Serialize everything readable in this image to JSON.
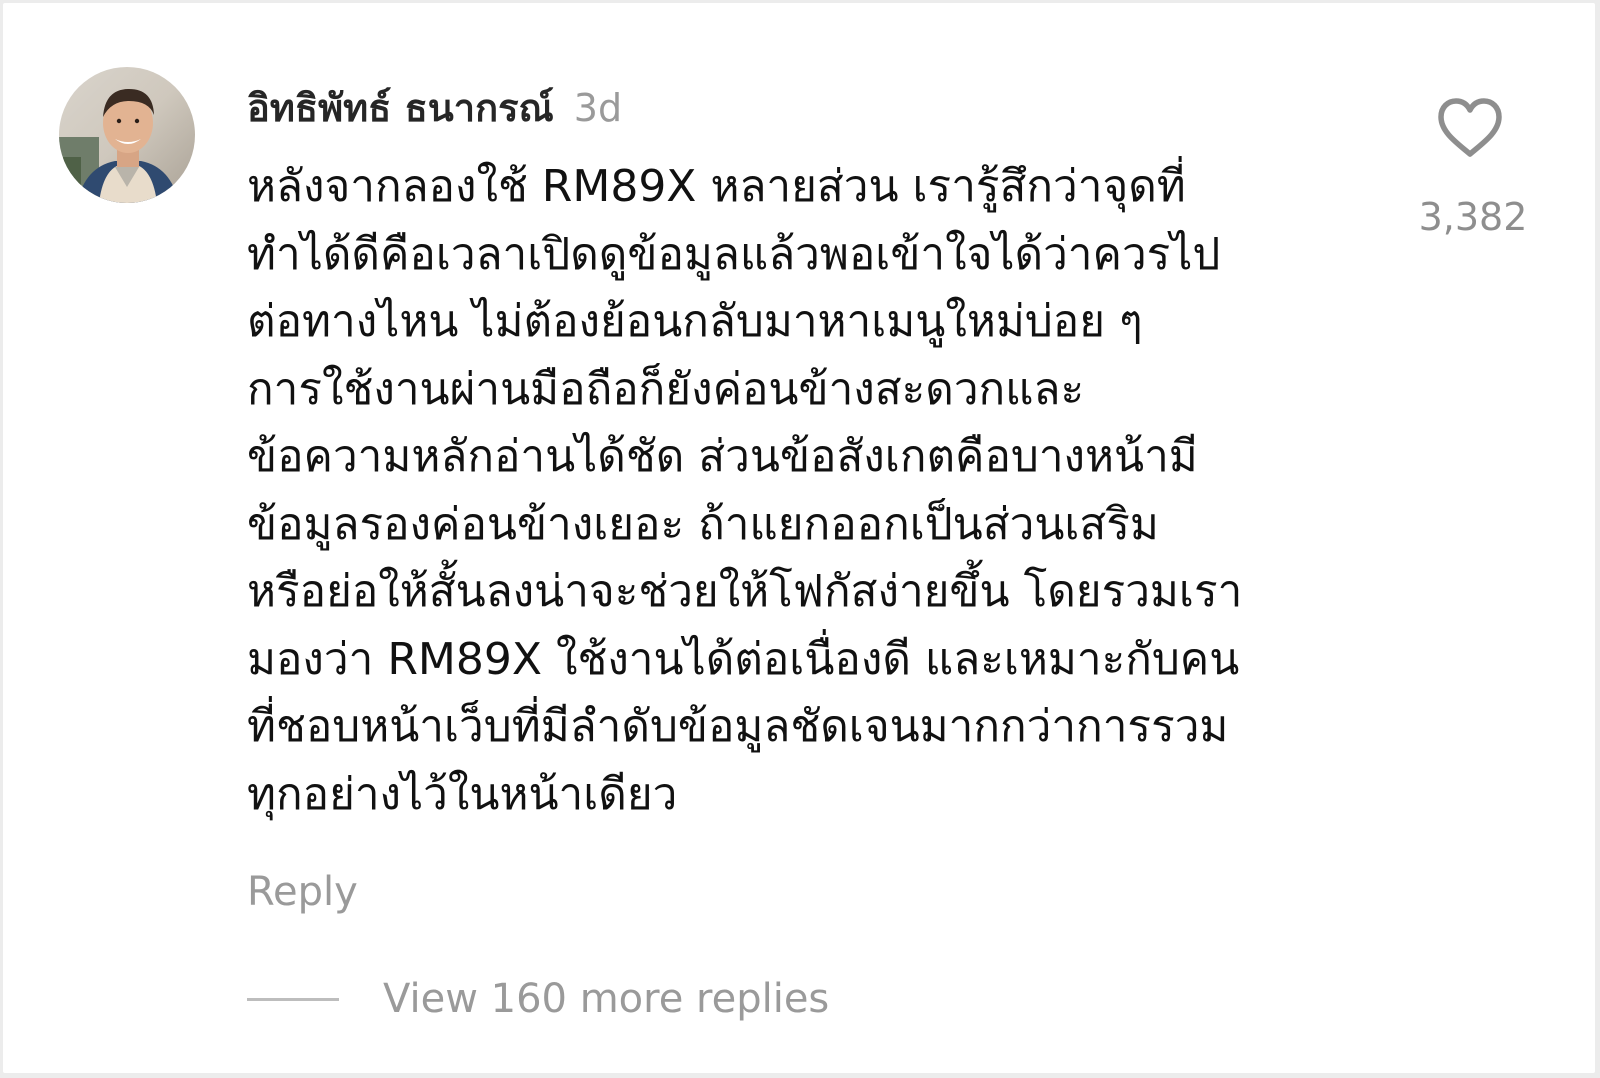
{
  "comment": {
    "username": "อิทธิพัทธ์ ธนากรณ์",
    "time": "3d",
    "body": "หลังจากลองใช้ RM89X หลายส่วน เรารู้สึกว่าจุดที่\nทำได้ดีคือเวลาเปิดดูข้อมูลแล้วพอเข้าใจได้ว่าควรไป\nต่อทางไหน ไม่ต้องย้อนกลับมาหาเมนูใหม่บ่อย ๆ\nการใช้งานผ่านมือถือก็ยังค่อนข้างสะดวกและ\nข้อความหลักอ่านได้ชัด ส่วนข้อสังเกตคือบางหน้ามี\nข้อมูลรองค่อนข้างเยอะ ถ้าแยกออกเป็นส่วนเสริม\nหรือย่อให้สั้นลงน่าจะช่วยให้โฟกัสง่ายขึ้น โดยรวมเรา\nมองว่า RM89X ใช้งานได้ต่อเนื่องดี และเหมาะกับคน\nที่ชอบหน้าเว็บที่มีลำดับข้อมูลชัดเจนมากกว่าการรวม\nทุกอย่างไว้ในหน้าเดียว",
    "like_count": "3,382",
    "reply_label": "Reply",
    "view_replies_label": "View 160 more replies"
  },
  "icons": {
    "like": "heart-outline-icon",
    "avatar": "user-avatar-photo"
  },
  "colors": {
    "background": "#ffffff",
    "text_primary": "#111111",
    "text_secondary": "#9a9a9a",
    "icon": "#8e8e8e"
  }
}
